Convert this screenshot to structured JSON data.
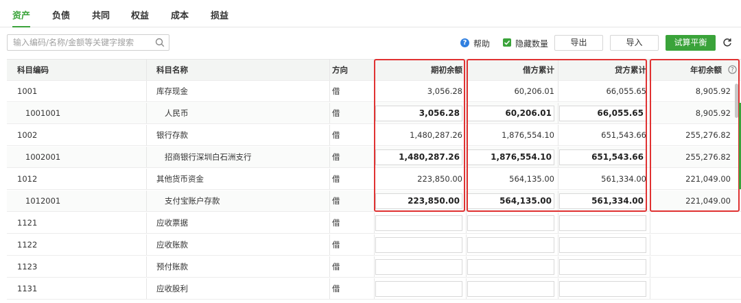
{
  "tabs": [
    {
      "label": "资产",
      "active": true
    },
    {
      "label": "负债",
      "active": false
    },
    {
      "label": "共同",
      "active": false
    },
    {
      "label": "权益",
      "active": false
    },
    {
      "label": "成本",
      "active": false
    },
    {
      "label": "损益",
      "active": false
    }
  ],
  "toolbar": {
    "search_placeholder": "输入编码/名称/金额等关键字搜索",
    "help_label": "帮助",
    "hide_qty_label": "隐藏数量",
    "hide_qty_checked": true,
    "export_label": "导出",
    "import_label": "导入",
    "trial_balance_label": "试算平衡"
  },
  "colors": {
    "accent": "#3aa33a",
    "help": "#2f7fe0",
    "highlight": "#e03131"
  },
  "table": {
    "headers": {
      "code": "科目编码",
      "name": "科目名称",
      "direction": "方向",
      "opening": "期初余额",
      "debit": "借方累计",
      "credit": "贷方累计",
      "year_start": "年初余额"
    },
    "rows": [
      {
        "code": "1001",
        "name": "库存现金",
        "direction": "借",
        "opening": "3,056.28",
        "debit": "60,206.01",
        "credit": "66,055.65",
        "year_start": "8,905.92"
      },
      {
        "code": "1001001",
        "name": "人民币",
        "direction": "借",
        "opening": "3,056.28",
        "debit": "60,206.01",
        "credit": "66,055.65",
        "year_start": "8,905.92"
      },
      {
        "code": "1002",
        "name": "银行存款",
        "direction": "借",
        "opening": "1,480,287.26",
        "debit": "1,876,554.10",
        "credit": "651,543.66",
        "year_start": "255,276.82"
      },
      {
        "code": "1002001",
        "name": "招商银行深圳白石洲支行",
        "direction": "借",
        "opening": "1,480,287.26",
        "debit": "1,876,554.10",
        "credit": "651,543.66",
        "year_start": "255,276.82"
      },
      {
        "code": "1012",
        "name": "其他货币资金",
        "direction": "借",
        "opening": "223,850.00",
        "debit": "564,135.00",
        "credit": "561,334.00",
        "year_start": "221,049.00"
      },
      {
        "code": "1012001",
        "name": "支付宝账户存款",
        "direction": "借",
        "opening": "223,850.00",
        "debit": "564,135.00",
        "credit": "561,334.00",
        "year_start": "221,049.00"
      },
      {
        "code": "1121",
        "name": "应收票据",
        "direction": "借",
        "opening": "",
        "debit": "",
        "credit": "",
        "year_start": ""
      },
      {
        "code": "1122",
        "name": "应收账款",
        "direction": "借",
        "opening": "",
        "debit": "",
        "credit": "",
        "year_start": ""
      },
      {
        "code": "1123",
        "name": "预付账款",
        "direction": "借",
        "opening": "",
        "debit": "",
        "credit": "",
        "year_start": ""
      },
      {
        "code": "1131",
        "name": "应收股利",
        "direction": "借",
        "opening": "",
        "debit": "",
        "credit": "",
        "year_start": ""
      }
    ]
  }
}
